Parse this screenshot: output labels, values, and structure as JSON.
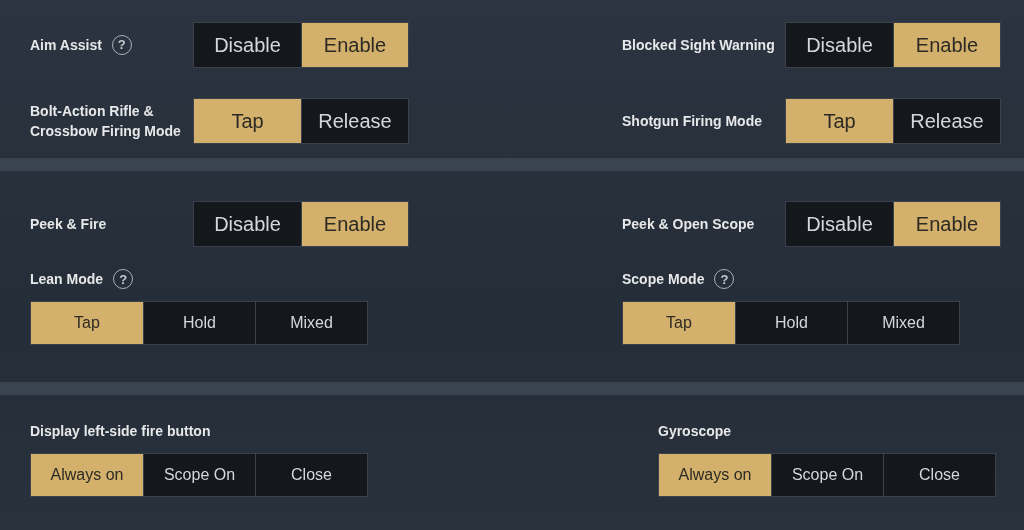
{
  "sections": [
    {
      "settings": [
        {
          "label": "Aim Assist",
          "help": "?",
          "kind": "inline",
          "options": [
            {
              "label": "Disable",
              "selected": false
            },
            {
              "label": "Enable",
              "selected": true
            }
          ]
        },
        {
          "label": "Blocked Sight Warning",
          "kind": "inline",
          "options": [
            {
              "label": "Disable",
              "selected": false
            },
            {
              "label": "Enable",
              "selected": true
            }
          ]
        },
        {
          "label": "Bolt-Action Rifle & Crossbow Firing Mode",
          "kind": "inline",
          "options": [
            {
              "label": "Tap",
              "selected": true
            },
            {
              "label": "Release",
              "selected": false
            }
          ]
        },
        {
          "label": "Shotgun Firing Mode",
          "kind": "inline",
          "options": [
            {
              "label": "Tap",
              "selected": true
            },
            {
              "label": "Release",
              "selected": false
            }
          ]
        }
      ]
    },
    {
      "settings": [
        {
          "label": "Peek & Fire",
          "kind": "inline",
          "options": [
            {
              "label": "Disable",
              "selected": false
            },
            {
              "label": "Enable",
              "selected": true
            }
          ]
        },
        {
          "label": "Peek & Open Scope",
          "kind": "inline",
          "options": [
            {
              "label": "Disable",
              "selected": false
            },
            {
              "label": "Enable",
              "selected": true
            }
          ]
        },
        {
          "label": "Lean Mode",
          "help": "?",
          "kind": "stacked",
          "options": [
            {
              "label": "Tap",
              "selected": true
            },
            {
              "label": "Hold",
              "selected": false
            },
            {
              "label": "Mixed",
              "selected": false
            }
          ]
        },
        {
          "label": "Scope Mode",
          "help": "?",
          "kind": "stacked",
          "options": [
            {
              "label": "Tap",
              "selected": true
            },
            {
              "label": "Hold",
              "selected": false
            },
            {
              "label": "Mixed",
              "selected": false
            }
          ]
        }
      ]
    },
    {
      "settings": [
        {
          "label": "Display left-side fire button",
          "kind": "stacked",
          "options": [
            {
              "label": "Always on",
              "selected": true
            },
            {
              "label": "Scope On",
              "selected": false
            },
            {
              "label": "Close",
              "selected": false
            }
          ]
        },
        {
          "label": "Gyroscope",
          "kind": "stacked",
          "options": [
            {
              "label": "Always on",
              "selected": true
            },
            {
              "label": "Scope On",
              "selected": false
            },
            {
              "label": "Close",
              "selected": false
            }
          ]
        }
      ]
    }
  ]
}
